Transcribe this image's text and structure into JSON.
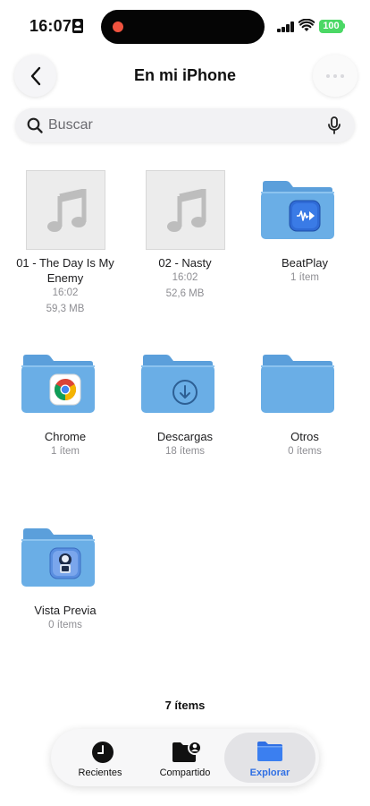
{
  "status_bar": {
    "time": "16:07",
    "battery": "100",
    "battery_color": "#4bd865",
    "recording_color": "#f0533f"
  },
  "header": {
    "title": "En mi iPhone",
    "back_icon": "chevron-left-icon",
    "more_icon": "ellipsis-icon"
  },
  "search": {
    "placeholder": "Buscar",
    "value": ""
  },
  "files": [
    {
      "kind": "audio",
      "name": "01 - The Day Is My Enemy",
      "time": "16:02",
      "size": "59,3 MB"
    },
    {
      "kind": "audio",
      "name": "02 - Nasty",
      "time": "16:02",
      "size": "52,6 MB"
    },
    {
      "kind": "folder",
      "name": "BeatPlay",
      "count": "1 ítem",
      "badge": "beatplay-app-icon"
    },
    {
      "kind": "folder",
      "name": "Chrome",
      "count": "1 ítem",
      "badge": "chrome-app-icon"
    },
    {
      "kind": "folder",
      "name": "Descargas",
      "count": "18 ítems",
      "badge": "download-icon"
    },
    {
      "kind": "folder",
      "name": "Otros",
      "count": "0 ítems",
      "badge": ""
    },
    {
      "kind": "folder",
      "name": "Vista Previa",
      "count": "0 ítems",
      "badge": "preview-app-icon"
    }
  ],
  "footer": {
    "items_count": "7 ítems"
  },
  "tabs": [
    {
      "label": "Recientes",
      "icon": "clock-icon",
      "active": false
    },
    {
      "label": "Compartido",
      "icon": "shared-folder-icon",
      "active": false
    },
    {
      "label": "Explorar",
      "icon": "folder-icon",
      "active": true
    }
  ],
  "colors": {
    "folder": "#6aaee6",
    "accent": "#2f6fe4"
  }
}
